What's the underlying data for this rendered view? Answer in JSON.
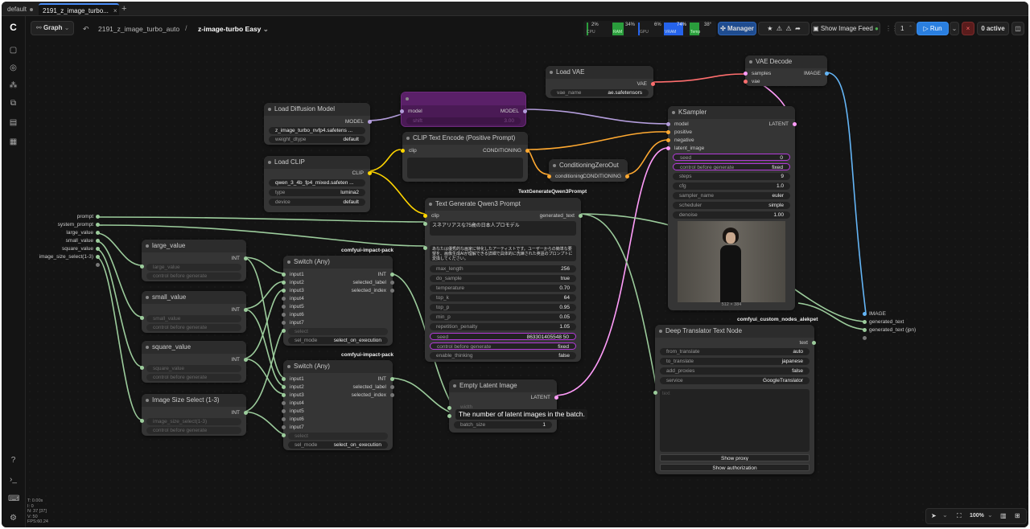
{
  "tabs": [
    {
      "label": "default"
    },
    {
      "label": "2191_z_image_turbo..."
    }
  ],
  "toolbar": {
    "graph_label": "Graph",
    "workflow_name": "2191_z_image_turbo_auto",
    "separator": "/",
    "subgraph": "z-image-turbo Easy",
    "cpu": "2%",
    "cpu_label": "CPU",
    "ram": "34%",
    "ram_label": "RAM",
    "gpu": "6%",
    "gpu_label": "GPU",
    "vram": "74%",
    "vram_label": "VRAM",
    "temp": "38°",
    "temp_label": "Temp",
    "manager": "Manager",
    "show_feed": "Show Image Feed",
    "queue_count": "1",
    "run": "Run",
    "active": "0 active"
  },
  "nodes": {
    "load_vae": {
      "title": "Load VAE",
      "out": "VAE",
      "w_name": "vae_name",
      "w_val": "ae.safetensors"
    },
    "vae_decode": {
      "title": "VAE Decode",
      "in1": "samples",
      "in2": "vae",
      "out": "IMAGE"
    },
    "load_diffusion": {
      "title": "Load Diffusion Model",
      "out": "MODEL",
      "w1": "z_image_turbo_nvfp4.safetens ...",
      "w2_name": "weight_dtype",
      "w2_val": "default"
    },
    "bypassed": {
      "in": "model",
      "out": "MODEL",
      "w": "shift",
      "wv": "3.00"
    },
    "clip_encode": {
      "title": "CLIP Text Encode (Positive Prompt)",
      "in": "clip",
      "out": "CONDITIONING"
    },
    "cond_zero": {
      "title": "ConditioningZeroOut",
      "in": "conditioning",
      "out": "CONDITIONING"
    },
    "load_clip": {
      "title": "Load CLIP",
      "out": "CLIP",
      "w1": "qwen_3_4b_fp4_mixed.safeten ...",
      "w2_name": "type",
      "w2_val": "lumina2",
      "w3_name": "device",
      "w3_val": "default"
    },
    "ksampler": {
      "title": "KSampler",
      "inputs": [
        "model",
        "positive",
        "negative",
        "latent_image"
      ],
      "out": "LATENT",
      "widgets": [
        {
          "n": "seed",
          "v": "0"
        },
        {
          "n": "control before generate",
          "v": "fixed"
        },
        {
          "n": "steps",
          "v": "9"
        },
        {
          "n": "cfg",
          "v": "1.0"
        },
        {
          "n": "sampler_name",
          "v": "euler"
        },
        {
          "n": "scheduler",
          "v": "simple"
        },
        {
          "n": "denoise",
          "v": "1.00"
        }
      ],
      "size": "512 × 384"
    },
    "text_gen": {
      "group": "TextGenerateQwen3Prompt",
      "title": "Text Generate Qwen3 Prompt",
      "in": "clip",
      "out": "generated_text",
      "prompt": "スネアリアスな75歳の日本人プロモデル",
      "system": "あなたは優秀的な画家に特化したアーティストです。ユーザーからの簡単な要望を、画像生成AIが理解できる詳細で具体的に洗練された英語のプロンプトに変換してください。",
      "widgets": [
        {
          "n": "max_length",
          "v": "256"
        },
        {
          "n": "do_sample",
          "v": "true"
        },
        {
          "n": "temperature",
          "v": "0.70"
        },
        {
          "n": "top_k",
          "v": "64"
        },
        {
          "n": "top_p",
          "v": "0.95"
        },
        {
          "n": "min_p",
          "v": "0.05"
        },
        {
          "n": "repetition_penalty",
          "v": "1.05"
        },
        {
          "n": "seed",
          "v": "863301405548 50"
        },
        {
          "n": "control before generate",
          "v": "fixed"
        },
        {
          "n": "enable_thinking",
          "v": "false"
        }
      ]
    },
    "primitives": {
      "outputs": [
        "prompt",
        "system_prompt",
        "large_value",
        "small_value",
        "square_value",
        "image_size_select(1-3)"
      ]
    },
    "large": {
      "title": "large_value",
      "out": "INT",
      "w": "large_value",
      "c": "control before generate"
    },
    "small": {
      "title": "small_value",
      "out": "INT",
      "w": "small_value",
      "c": "control before generate"
    },
    "square": {
      "title": "square_value",
      "out": "INT",
      "w": "square_value",
      "c": "control before generate"
    },
    "sizesel": {
      "title": "Image Size Select (1-3)",
      "out": "INT",
      "w": "image_size_select(1-3)",
      "c": "control before generate"
    },
    "switch1": {
      "group": "comfyui-impact-pack",
      "title": "Switch (Any)",
      "inputs": [
        "input1",
        "input2",
        "input3",
        "input4",
        "input5",
        "input6",
        "input7"
      ],
      "outs": [
        "INT",
        "selected_label",
        "selected_index"
      ],
      "sel": "select",
      "mode_n": "sel_mode",
      "mode_v": "select_on_execution"
    },
    "switch2": {
      "group": "comfyui-impact-pack",
      "title": "Switch (Any)",
      "inputs": [
        "input1",
        "input2",
        "input3",
        "input4",
        "input5",
        "input6",
        "input7"
      ],
      "outs": [
        "INT",
        "selected_label",
        "selected_index"
      ],
      "sel": "select",
      "mode_n": "sel_mode",
      "mode_v": "select_on_execution"
    },
    "empty_latent": {
      "title": "Empty Latent Image",
      "out": "LATENT",
      "tooltip": "The number of latent images in the batch.",
      "w": "batch_size",
      "wv": "1",
      "w0": "width"
    },
    "translator": {
      "group": "comfyui_custom_nodes_alekpet",
      "title": "Deep Translator Text Node",
      "out": "text",
      "widgets": [
        {
          "n": "from_translate",
          "v": "auto"
        },
        {
          "n": "to_translate",
          "v": "japanese"
        },
        {
          "n": "add_proxies",
          "v": "false"
        },
        {
          "n": "service",
          "v": "GoogleTranslator"
        }
      ],
      "placeholder": "text",
      "b1": "Show proxy",
      "b2": "Show authorization"
    },
    "preview": {
      "outputs": [
        "IMAGE",
        "generated_text",
        "generated_text (jpn)"
      ]
    }
  },
  "footer": {
    "stats": [
      "T: 0.00s",
      "I: 0",
      "N: 37 [37]",
      "V: 50",
      "FPS:60.24"
    ],
    "zoom": "100%"
  },
  "colors": {
    "model": "#b39ddb",
    "clip": "#ffd500",
    "cond": "#ffa931",
    "latent": "#ff9cf9",
    "vae": "#ff6e6e",
    "image": "#64b5f6",
    "int": "#7dc27d",
    "accent": "#4a8df8"
  }
}
